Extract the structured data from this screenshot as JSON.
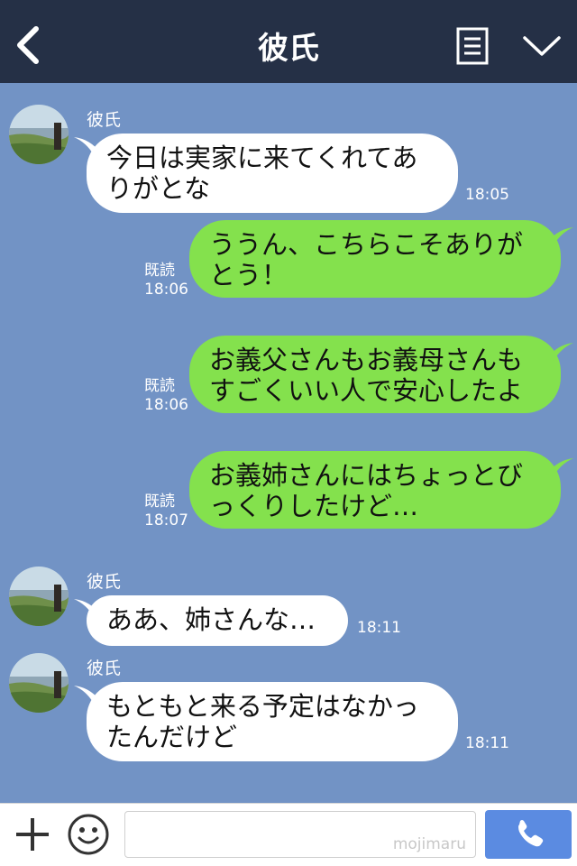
{
  "header": {
    "title": "彼氏",
    "back_icon": "chevron-left-icon",
    "menu_icon": "list-icon",
    "dropdown_icon": "chevron-down-icon"
  },
  "messages": [
    {
      "direction": "in",
      "sender": "彼氏",
      "lines": [
        "今日は実家に来てくれてあ",
        "りがとな"
      ],
      "time": "18:05"
    },
    {
      "direction": "out",
      "lines": [
        "ううん、こちらこそありが",
        "とう！"
      ],
      "read": "既読",
      "time": "18:06"
    },
    {
      "direction": "out",
      "lines": [
        "お義父さんもお義母さんも",
        "すごくいい人で安心したよ"
      ],
      "read": "既読",
      "time": "18:06"
    },
    {
      "direction": "out",
      "lines": [
        "お義姉さんにはちょっとび",
        "っくりしたけど…"
      ],
      "read": "既読",
      "time": "18:07"
    },
    {
      "direction": "in",
      "sender": "彼氏",
      "lines": [
        "ああ、姉さんな…"
      ],
      "time": "18:11"
    },
    {
      "direction": "in",
      "sender": "彼氏",
      "lines": [
        "もともと来る予定はなかっ",
        "たんだけど"
      ],
      "time": "18:11"
    }
  ],
  "footer": {
    "plus_icon": "plus-icon",
    "emoji_icon": "smiley-icon",
    "input_value": "",
    "watermark": "mojimaru",
    "call_icon": "phone-icon"
  },
  "colors": {
    "header_bg": "#253046",
    "chat_bg": "#7293c5",
    "outgoing_bubble": "#84e14d",
    "incoming_bubble": "#ffffff",
    "call_button": "#5b8be1"
  }
}
